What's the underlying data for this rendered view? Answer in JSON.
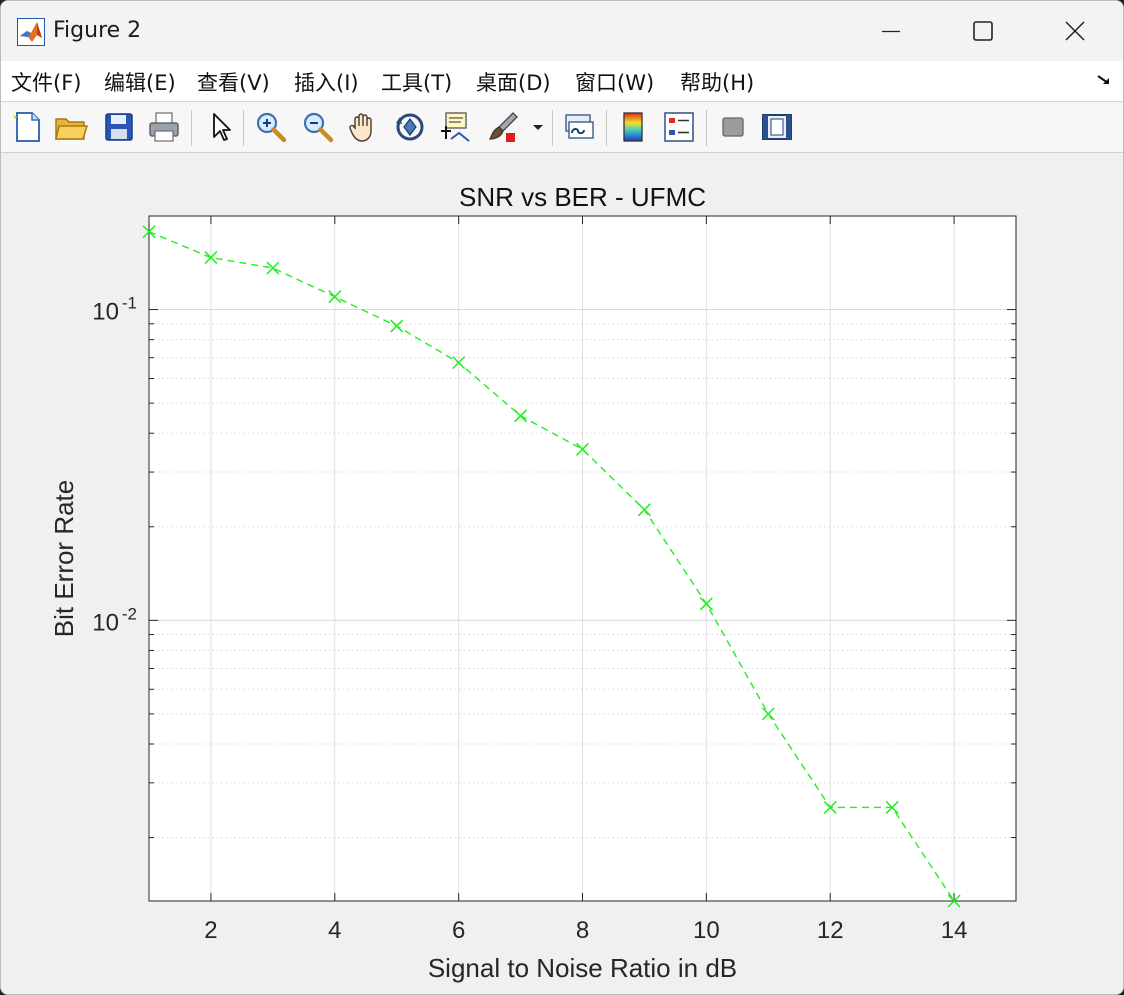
{
  "window": {
    "title": "Figure 2",
    "controls": {
      "minimize": "minimize",
      "maximize": "maximize",
      "close": "close"
    }
  },
  "menu": [
    {
      "label": "文件(F)",
      "id": "file"
    },
    {
      "label": "编辑(E)",
      "id": "edit"
    },
    {
      "label": "查看(V)",
      "id": "view"
    },
    {
      "label": "插入(I)",
      "id": "insert"
    },
    {
      "label": "工具(T)",
      "id": "tools"
    },
    {
      "label": "桌面(D)",
      "id": "desktop"
    },
    {
      "label": "窗口(W)",
      "id": "window"
    },
    {
      "label": "帮助(H)",
      "id": "help"
    }
  ],
  "toolbar": [
    {
      "icon": "new-figure-icon"
    },
    {
      "icon": "open-file-icon"
    },
    {
      "icon": "save-icon"
    },
    {
      "icon": "print-icon"
    },
    {
      "icon": "edit-plot-arrow-icon"
    },
    {
      "icon": "zoom-in-icon"
    },
    {
      "icon": "zoom-out-icon"
    },
    {
      "icon": "pan-hand-icon"
    },
    {
      "icon": "rotate-3d-icon"
    },
    {
      "icon": "data-cursor-icon"
    },
    {
      "icon": "brush-icon"
    },
    {
      "icon": "brush-dropdown-icon"
    },
    {
      "icon": "link-plot-icon"
    },
    {
      "icon": "colorbar-icon"
    },
    {
      "icon": "legend-icon"
    },
    {
      "icon": "hide-plot-tools-icon"
    },
    {
      "icon": "show-plot-tools-icon"
    }
  ],
  "chart_data": {
    "type": "line",
    "title": "SNR vs BER - UFMC",
    "xlabel": "Signal to Noise Ratio in dB",
    "ylabel": "Bit Error Rate",
    "x": [
      1,
      2,
      3,
      4,
      5,
      6,
      7,
      8,
      9,
      10,
      11,
      12,
      13,
      14
    ],
    "series": [
      {
        "values": [
          0.178,
          0.147,
          0.136,
          0.11,
          0.0885,
          0.0675,
          0.0455,
          0.0355,
          0.0227,
          0.0113,
          0.005,
          0.0025,
          0.0025,
          0.00125
        ],
        "color": "#22ee22",
        "line_style": "dashed",
        "marker": "x"
      }
    ],
    "xlim": [
      1,
      15
    ],
    "ylim": [
      0.00125,
      0.2
    ],
    "yscale": "log",
    "xticks": [
      "2",
      "4",
      "6",
      "8",
      "10",
      "12",
      "14"
    ],
    "yticks": [
      {
        "base": "10",
        "exp": "-1"
      },
      {
        "base": "10",
        "exp": "-2"
      }
    ],
    "grid": true
  }
}
